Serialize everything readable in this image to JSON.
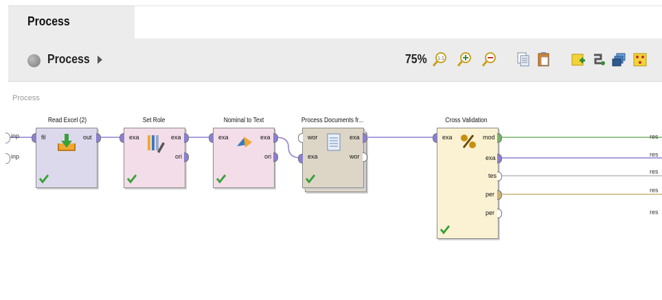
{
  "tab": {
    "title": "Process"
  },
  "toolbar": {
    "process_label": "Process",
    "zoom": "75%"
  },
  "canvas": {
    "title": "Process"
  },
  "operators": {
    "read_excel": {
      "title": "Read Excel (2)",
      "ports_in": [
        "fil"
      ],
      "ports_out": [
        "out"
      ]
    },
    "set_role": {
      "title": "Set Role",
      "ports_in": [
        "exa"
      ],
      "ports_out": [
        "exa",
        "ori"
      ]
    },
    "nominal_to_text": {
      "title": "Nominal to Text",
      "ports_in": [
        "exa"
      ],
      "ports_out": [
        "exa",
        "ori"
      ]
    },
    "process_documents": {
      "title": "Process Documents fr...",
      "ports_in": [
        "wor",
        "exa"
      ],
      "ports_out": [
        "exa",
        "wor"
      ]
    },
    "cross_validation": {
      "title": "Cross Validation",
      "ports_in": [
        "exa"
      ],
      "ports_out": [
        "mod",
        "exa",
        "tes",
        "per",
        "per"
      ]
    }
  },
  "process_inputs": [
    "inp",
    "inp"
  ],
  "process_results": [
    "res",
    "res",
    "res",
    "res",
    "res"
  ],
  "colors": {
    "example_wire": "#8a7fd0",
    "model_wire": "#76b26a",
    "perf_wire": "#c9b27a",
    "tes_wire": "#9a9a9a"
  }
}
